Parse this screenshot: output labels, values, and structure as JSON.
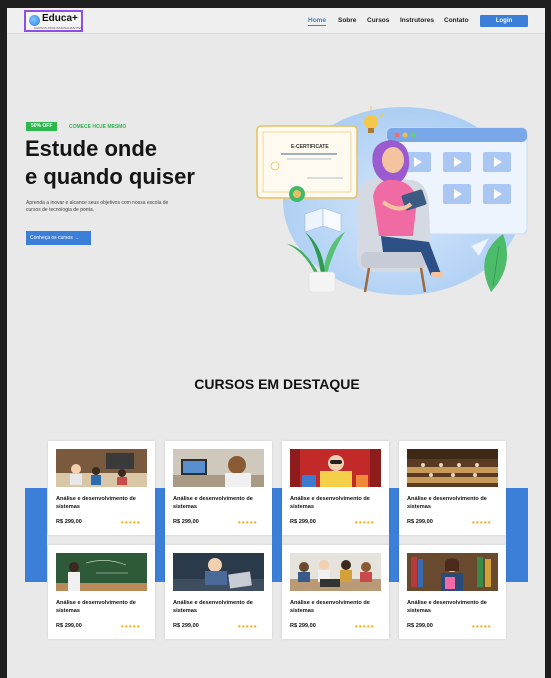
{
  "header": {
    "logo_text": "Educa+",
    "logo_sub": "CURSOS PROFISSIONALIZANTES",
    "nav": [
      {
        "label": "Home"
      },
      {
        "label": "Sobre"
      },
      {
        "label": "Cursos"
      },
      {
        "label": "Instrutores"
      },
      {
        "label": "Contato"
      }
    ],
    "login_label": "Login"
  },
  "hero": {
    "badge": "50% OFF",
    "tag": "COMECE HOJE MESMO",
    "title_line1": "Estude onde",
    "title_line2": "e quando quiser",
    "description": "Aprenda a inovar e alcance seus objetivos com nossa escola de cursos de tecnologia de ponta.",
    "cta_label": "Conheça os cursos →",
    "certificate_label": "E-CERTIFICATE"
  },
  "featured": {
    "title": "CURSOS EM DESTAQUE",
    "courses": [
      {
        "title": "Análise e desenvolvimento de sistemas",
        "price": "R$ 299,00",
        "rating": "★★★★★"
      },
      {
        "title": "Análise e desenvolvimento de sistemas",
        "price": "R$ 299,00",
        "rating": "★★★★★"
      },
      {
        "title": "Análise e desenvolvimento de sistemas",
        "price": "R$ 299,00",
        "rating": "★★★★★"
      },
      {
        "title": "Análise e desenvolvimento de sistemas",
        "price": "R$ 299,00",
        "rating": "★★★★★"
      },
      {
        "title": "Análise e desenvolvimento de sistemas",
        "price": "R$ 299,00",
        "rating": "★★★★★"
      },
      {
        "title": "Análise e desenvolvimento de sistemas",
        "price": "R$ 299,00",
        "rating": "★★★★★"
      },
      {
        "title": "Análise e desenvolvimento de sistemas",
        "price": "R$ 299,00",
        "rating": "★★★★★"
      },
      {
        "title": "Análise e desenvolvimento de sistemas",
        "price": "R$ 299,00",
        "rating": "★★★★★"
      }
    ]
  },
  "colors": {
    "accent": "#3b7fd9",
    "badge": "#2db84d",
    "logo_border": "#8f4fe6",
    "stars": "#f2b01e"
  }
}
